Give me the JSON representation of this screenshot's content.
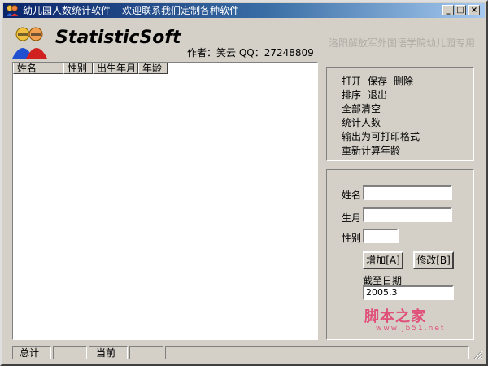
{
  "titlebar": {
    "title": "幼儿园人数统计软件",
    "subtitle": "欢迎联系我们定制各种软件",
    "buttons": {
      "minimize": "_",
      "maximize": "□",
      "close": "×"
    }
  },
  "header": {
    "brand": "StatisticSoft",
    "author": "作者：笑云   QQ：27248809",
    "school": "洛阳解放军外国语学院幼儿园专用"
  },
  "table": {
    "columns": [
      "姓名",
      "性别",
      "出生年月",
      "年龄"
    ],
    "rows": []
  },
  "menu": {
    "open": "打开",
    "save": "保存",
    "delete": "删除",
    "sort": "排序",
    "exit": "退出",
    "clear_all": "全部清空",
    "count": "统计人数",
    "export_print": "输出为可打印格式",
    "recalc_age": "重新计算年龄"
  },
  "form": {
    "name_label": "姓名",
    "birth_label": "生月",
    "gender_label": "性别",
    "name_value": "",
    "birth_value": "",
    "gender_value": "",
    "add_button": "增加[A]",
    "modify_button": "修改[B]",
    "cutoff_label": "截至日期",
    "cutoff_value": "2005.3"
  },
  "watermark": {
    "text": "脚本之家",
    "url": "www.jb51.net"
  },
  "statusbar": {
    "total_label": "总计",
    "total_value": "",
    "current_label": "当前",
    "current_value": ""
  },
  "colors": {
    "face": "#d4d0c8",
    "title_start": "#0a246a",
    "title_end": "#a6caf0",
    "watermark": "#e0507a"
  }
}
